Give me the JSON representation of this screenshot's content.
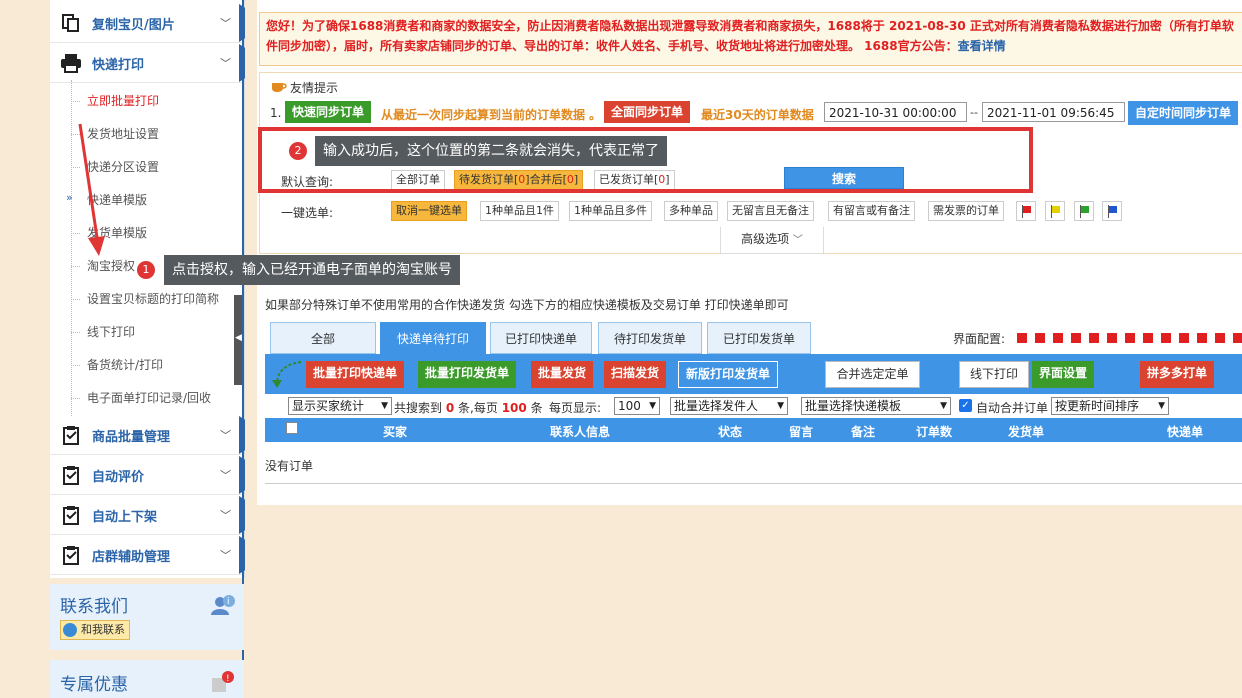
{
  "sidebar": {
    "copy_label": "复制宝贝/图片",
    "express_label": "快递打印",
    "sub_items": [
      "立即批量打印",
      "发货地址设置",
      "快递分区设置",
      "快递单模版",
      "发货单模版",
      "淘宝授权",
      "设置宝贝标题的打印简称",
      "线下打印",
      "备货统计/打印",
      "电子面单打印记录/回收"
    ],
    "sections": [
      "商品批量管理",
      "自动评价",
      "自动上下架",
      "店群辅助管理"
    ],
    "contact_title": "联系我们",
    "contact_btn": "和我联系",
    "promo_title": "专属优惠"
  },
  "notice": {
    "text": "您好！为了确保1688消费者和商家的数据安全，防止因消费者隐私数据出现泄露导致消费者和商家损失，1688将于 2021-08-30 正式对所有消费者隐私数据进行加密（所有打单软件同步加密），届时，所有卖家店铺同步的订单、导出的订单：收件人姓名、手机号、收货地址将进行加密处理。 1688官方公告：",
    "link": "查看详情"
  },
  "tips": {
    "title": "友情提示",
    "num": "1.",
    "quick_sync": "快速同步订单",
    "quick_sync_desc": "从最近一次同步起算到当前的订单数据 。",
    "full_sync": "全面同步订单",
    "full_sync_desc": "最近30天的订单数据",
    "date_from": "2021-10-31 00:00:00",
    "date_sep": "--",
    "date_to": "2021-11-01 09:56:45",
    "custom_sync": "自定时间同步订单"
  },
  "query": {
    "default_label": "默认查询:",
    "all_orders": "全部订单",
    "pending_prefix": "待发货订单[",
    "pending_count": "0",
    "pending_mid": "]合并后[",
    "pending_merged": "0",
    "pending_suffix": "]",
    "shipped_prefix": "已发货订单[",
    "shipped_count": "0",
    "shipped_suffix": "]",
    "search": "搜索",
    "one_click_label": "一键选单:",
    "chips": [
      "取消一键选单",
      "1种单品且1件",
      "1种单品且多件",
      "多种单品",
      "无留言且无备注",
      "有留言或有备注",
      "需发票的订单"
    ],
    "advanced": "高级选项"
  },
  "callout1": {
    "num": "1",
    "text": "点击授权，输入已经开通电子面单的淘宝账号"
  },
  "callout2": {
    "num": "2",
    "text": "输入成功后，这个位置的第二条就会消失，代表正常了"
  },
  "special_note": "如果部分特殊订单不使用常用的合作快递发货 勾选下方的相应快递模板及交易订单 打印快递单即可",
  "ui_config": "界面配置:",
  "tabs": [
    "全部",
    "快递单待打印",
    "已打印快递单",
    "待打印发货单",
    "已打印发货单"
  ],
  "toolbar": {
    "batch_print_express": "批量打印快递单",
    "batch_print_ship": "批量打印发货单",
    "batch_ship": "批量发货",
    "scan_ship": "扫描发货",
    "new_print_ship": "新版打印发货单",
    "merge": "合并选定定单",
    "offline_print": "线下打印",
    "ui_settings": "界面设置",
    "pdd_print": "拼多多打单"
  },
  "filters": {
    "buyer_stats": "显示买家统计",
    "found_prefix": "共搜索到",
    "found_count": "0",
    "found_mid": "条,每页",
    "per_page_count": "100",
    "found_suffix": "条",
    "per_page_label": "每页显示:",
    "per_page_select": "100",
    "sender_select": "批量选择发件人",
    "template_select": "批量选择快递模板",
    "auto_merge": "自动合并订单",
    "sort_select": "按更新时间排序"
  },
  "table_headers": [
    "买家",
    "联系人信息",
    "状态",
    "留言",
    "备注",
    "订单数",
    "发货单",
    "快递单"
  ],
  "empty_text": "没有订单",
  "colors": {
    "accent": "#3f94e6",
    "red": "#d9432f",
    "green": "#3a9b2a",
    "nav": "#2b64a8"
  }
}
